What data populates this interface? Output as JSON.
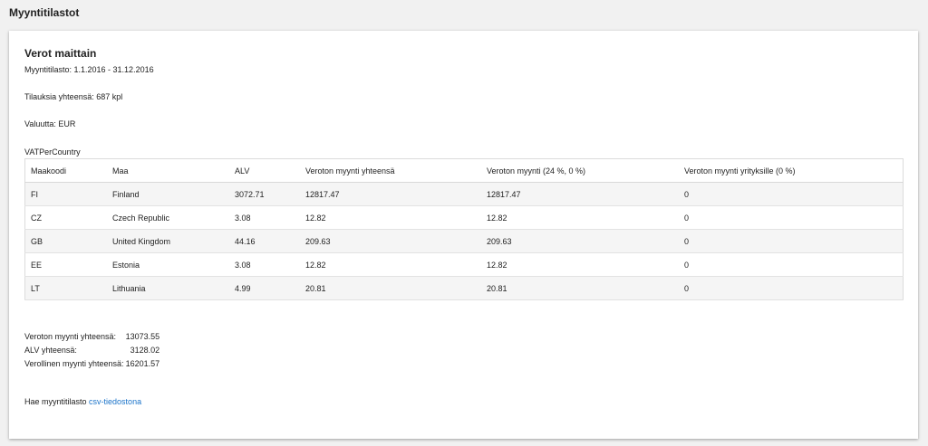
{
  "page": {
    "title": "Myyntitilastot"
  },
  "report": {
    "title": "Verot maittain",
    "period": "Myyntitilasto: 1.1.2016 - 31.12.2016",
    "orders": "Tilauksia yhteensä: 687 kpl",
    "currency": "Valuutta: EUR"
  },
  "table": {
    "caption": "VATPerCountry",
    "headers": [
      "Maakoodi",
      "Maa",
      "ALV",
      "Veroton myynti yhteensä",
      "Veroton myynti (24 %, 0 %)",
      "Veroton myynti yrityksille (0 %)"
    ],
    "rows": [
      [
        "FI",
        "Finland",
        "3072.71",
        "12817.47",
        "12817.47",
        "0"
      ],
      [
        "CZ",
        "Czech Republic",
        "3.08",
        "12.82",
        "12.82",
        "0"
      ],
      [
        "GB",
        "United Kingdom",
        "44.16",
        "209.63",
        "209.63",
        "0"
      ],
      [
        "EE",
        "Estonia",
        "3.08",
        "12.82",
        "12.82",
        "0"
      ],
      [
        "LT",
        "Lithuania",
        "4.99",
        "20.81",
        "20.81",
        "0"
      ]
    ]
  },
  "totals": [
    {
      "label": "Veroton myynti yhteensä:",
      "value": "13073.55"
    },
    {
      "label": "ALV yhteensä:",
      "value": "3128.02"
    },
    {
      "label": "Verollinen myynti yhteensä:",
      "value": "16201.57"
    }
  ],
  "csv": {
    "text": "Hae myyntitilasto",
    "link_label": "csv-tiedostona"
  },
  "colors": {
    "background": "#f1f1f1",
    "panel": "#ffffff",
    "link": "#1a73c9",
    "row_stripe": "#f5f5f5"
  }
}
